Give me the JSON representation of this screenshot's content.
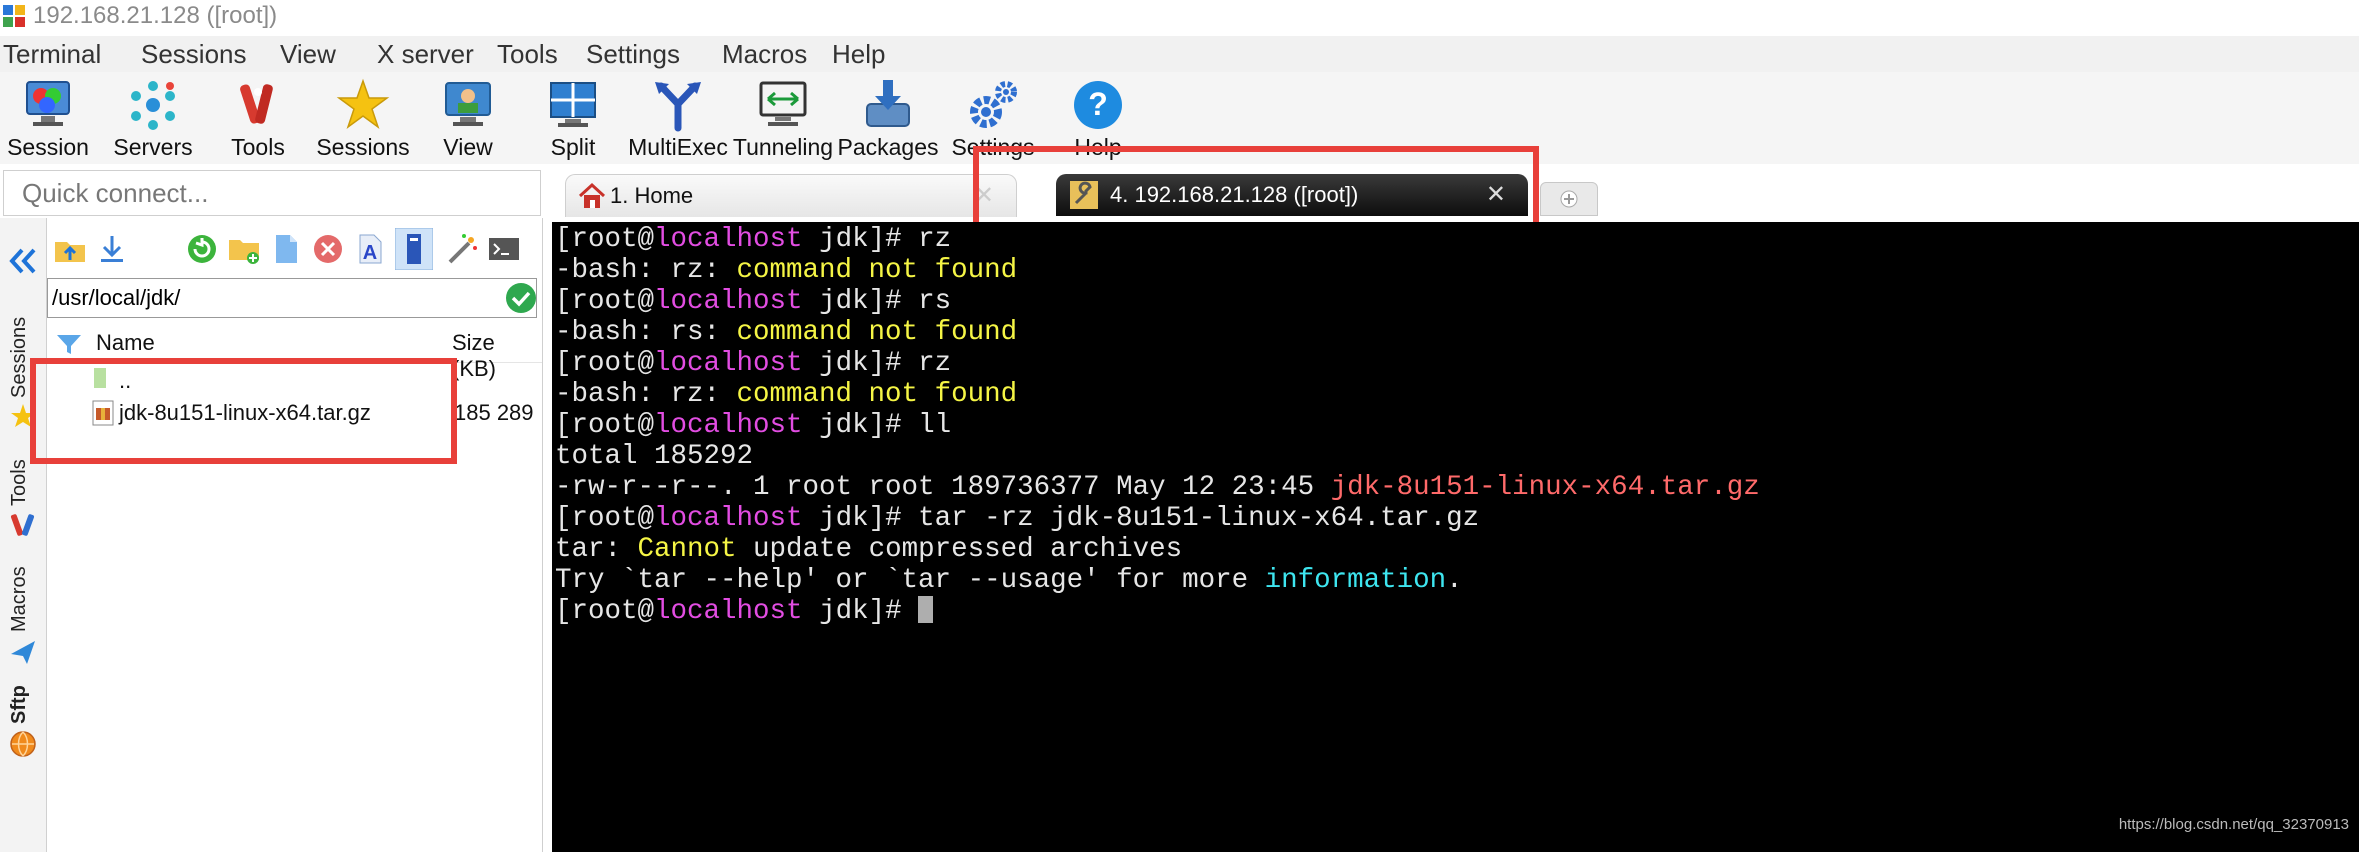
{
  "window": {
    "title": "192.168.21.128 ([root])"
  },
  "menu": [
    "Terminal",
    "Sessions",
    "View",
    "X server",
    "Tools",
    "Settings",
    "Macros",
    "Help"
  ],
  "toolbar": [
    "Session",
    "Servers",
    "Tools",
    "Sessions",
    "View",
    "Split",
    "MultiExec",
    "Tunneling",
    "Packages",
    "Settings",
    "Help"
  ],
  "quick_connect": {
    "placeholder": "Quick connect..."
  },
  "side_tabs": [
    "Sessions",
    "Tools",
    "Macros",
    "Sftp"
  ],
  "sftp": {
    "path": "/usr/local/jdk/",
    "columns": {
      "name": "Name",
      "size": "Size (KB)"
    },
    "files": [
      {
        "name": "..",
        "size": ""
      },
      {
        "name": "jdk-8u151-linux-x64.tar.gz",
        "size": "185 289"
      }
    ]
  },
  "tabs": {
    "home": "1. Home",
    "active": "4. 192.168.21.128 ([root])"
  },
  "terminal": {
    "user": "root",
    "host": "localhost",
    "dir": "jdk",
    "lines": [
      {
        "kind": "prompt",
        "cmd": "rz"
      },
      {
        "kind": "err",
        "prefix": "-bash: ",
        "name": "rz",
        "msg": "command not found"
      },
      {
        "kind": "prompt",
        "cmd": "rs"
      },
      {
        "kind": "err",
        "prefix": "-bash: ",
        "name": "rs",
        "msg": "command not found"
      },
      {
        "kind": "prompt",
        "cmd": "rz"
      },
      {
        "kind": "err",
        "prefix": "-bash: ",
        "name": "rz",
        "msg": "command not found"
      },
      {
        "kind": "prompt",
        "cmd": "ll"
      },
      {
        "kind": "text",
        "text": "total 185292"
      },
      {
        "kind": "file",
        "text": "-rw-r--r--. 1 root root 189736377 May 12 23:45 ",
        "file": "jdk-8u151-linux-x64.tar.gz"
      },
      {
        "kind": "prompt",
        "cmd": "tar -rz jdk-8u151-linux-x64.tar.gz"
      },
      {
        "kind": "tarerr",
        "a": "tar: ",
        "b": "Cannot",
        "c": " update compressed archives"
      },
      {
        "kind": "help",
        "a": "Try `tar --help' or `tar --usage' for more ",
        "b": "information",
        "c": "."
      },
      {
        "kind": "prompt",
        "cmd": "",
        "cursor": true
      }
    ]
  },
  "watermark": "https://blog.csdn.net/qq_32370913",
  "colors": {
    "highlight": "#e8403a",
    "prompt_user_host": "#e24de2",
    "error_text": "#f5f545",
    "filename": "#ff6a6a",
    "info_word": "#3ee6f0"
  }
}
